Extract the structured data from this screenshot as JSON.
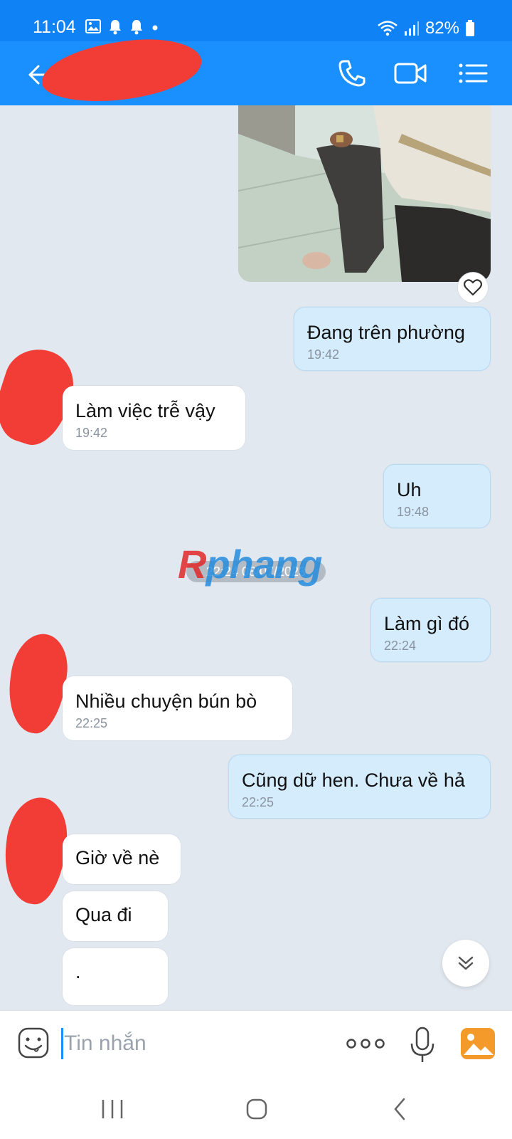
{
  "status": {
    "time": "11:04",
    "battery": "82%",
    "icons": [
      "gallery-icon",
      "bell-icon",
      "bell-icon",
      "dot-icon",
      "wifi-icon",
      "signal-icon",
      "battery-icon"
    ]
  },
  "header": {
    "icons": [
      "back-arrow-icon",
      "phone-icon",
      "video-call-icon",
      "menu-list-icon"
    ]
  },
  "messages": [
    {
      "direction": "out",
      "text": "Đang trên phường",
      "time": "19:42"
    },
    {
      "direction": "in",
      "text": "Làm việc trễ vậy",
      "time": "19:42"
    },
    {
      "direction": "out",
      "text": "Uh",
      "time": "19:48"
    },
    {
      "direction": "out",
      "text": "Làm gì đó",
      "time": "22:24"
    },
    {
      "direction": "in",
      "text": "Nhiều chuyện bún bò",
      "time": "22:25"
    },
    {
      "direction": "out",
      "text": "Cũng dữ hen. Chưa về hả",
      "time": "22:25"
    },
    {
      "direction": "in",
      "text": "Giờ về nè",
      "time": ""
    },
    {
      "direction": "in",
      "text": "Qua đi",
      "time": ""
    },
    {
      "direction": "in",
      "text": ".",
      "time": ""
    }
  ],
  "date_separator": "22:24 08/07/2023",
  "watermark": {
    "r": "R",
    "rest": "phang"
  },
  "composer": {
    "placeholder": "Tin nhắn",
    "icons": [
      "emoji-icon",
      "more-options-icon",
      "microphone-icon",
      "gallery-icon"
    ]
  },
  "colors": {
    "header": "#1a90ff",
    "status_bar": "#0f82f5",
    "chat_bg": "#e2e8ef",
    "outgoing_bubble": "#d5ecfd",
    "incoming_bubble": "#ffffff",
    "redaction": "#f23c36"
  }
}
